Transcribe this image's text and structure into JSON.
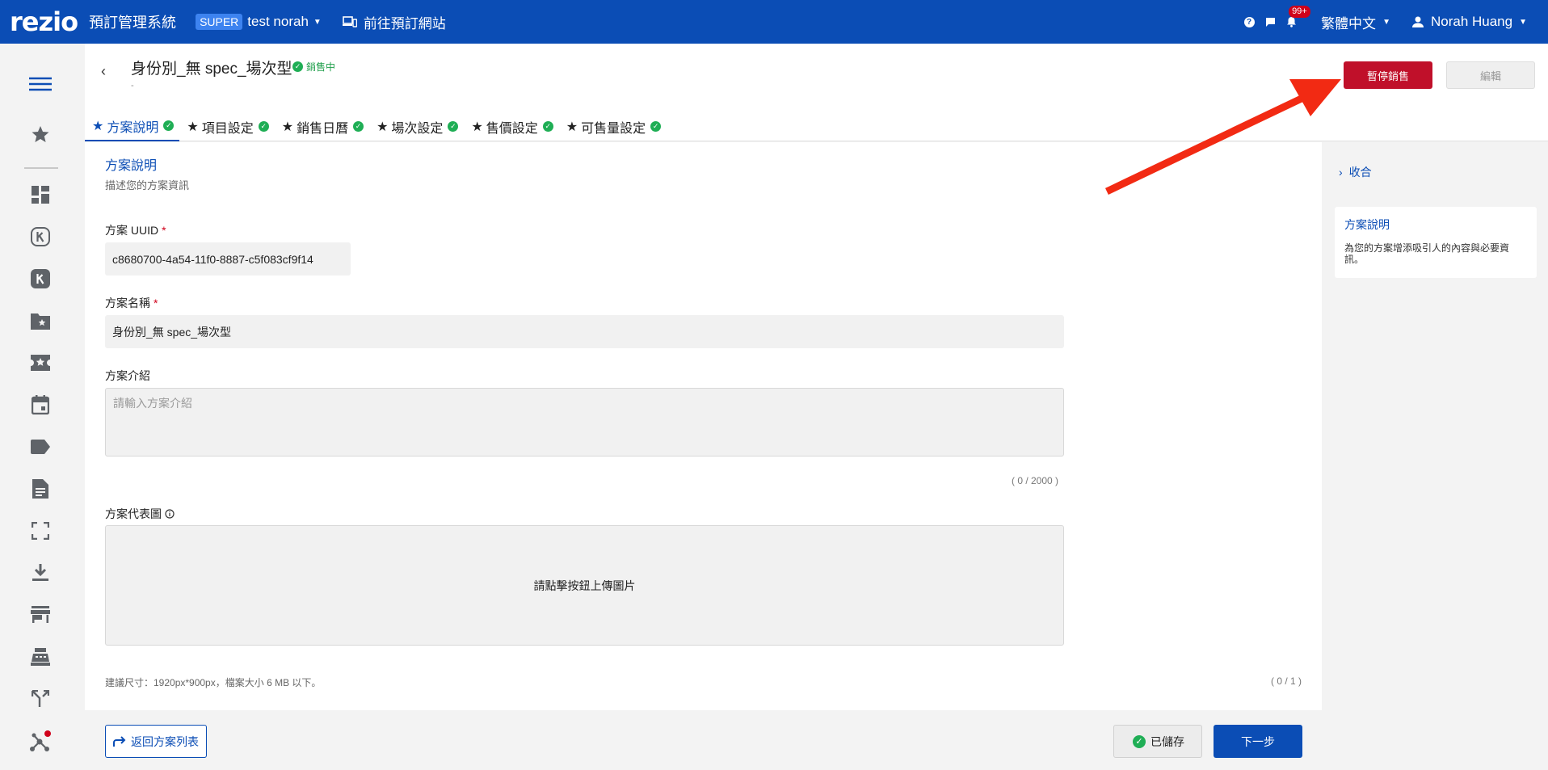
{
  "topbar": {
    "logo": "rezio",
    "system_name": "預訂管理系統",
    "super_badge": "SUPER",
    "org_name": "test norah",
    "goto_site": "前往預訂網站",
    "notification_count": "99+",
    "language": "繁體中文",
    "user_name": "Norah Huang"
  },
  "header": {
    "back": "‹",
    "title": "身份別_無 spec_場次型",
    "status": "銷售中",
    "subtitle": "-",
    "pause_button": "暫停銷售",
    "edit_button": "編輯",
    "tabs": [
      {
        "label": "方案說明",
        "active": true
      },
      {
        "label": "項目設定",
        "active": false
      },
      {
        "label": "銷售日曆",
        "active": false
      },
      {
        "label": "場次設定",
        "active": false
      },
      {
        "label": "售價設定",
        "active": false
      },
      {
        "label": "可售量設定",
        "active": false
      }
    ]
  },
  "form": {
    "section_title": "方案說明",
    "section_subtitle": "描述您的方案資訊",
    "uuid_label": "方案 UUID",
    "uuid_value": "c8680700-4a54-11f0-8887-c5f083cf9f14",
    "name_label": "方案名稱",
    "name_value": "身份別_無 spec_場次型",
    "intro_label": "方案介紹",
    "intro_placeholder": "請輸入方案介紹",
    "intro_counter": "( 0 / 2000 )",
    "image_label": "方案代表圖",
    "upload_text": "請點擊按鈕上傳圖片",
    "image_hint": "建議尺寸：1920px*900px，檔案大小 6 MB 以下。",
    "image_counter": "( 0 / 1 )",
    "required_mark": "*"
  },
  "right_panel": {
    "collapse_label": "收合",
    "card_title": "方案說明",
    "card_text": "為您的方案增添吸引人的內容與必要資訊。"
  },
  "footer": {
    "return_button": "返回方案列表",
    "saved_button": "已儲存",
    "next_button": "下一步"
  },
  "colors": {
    "brand_blue": "#0b4db5",
    "danger_red": "#c0102a",
    "success_green": "#1fae55",
    "arrow_red": "#f22a13"
  }
}
